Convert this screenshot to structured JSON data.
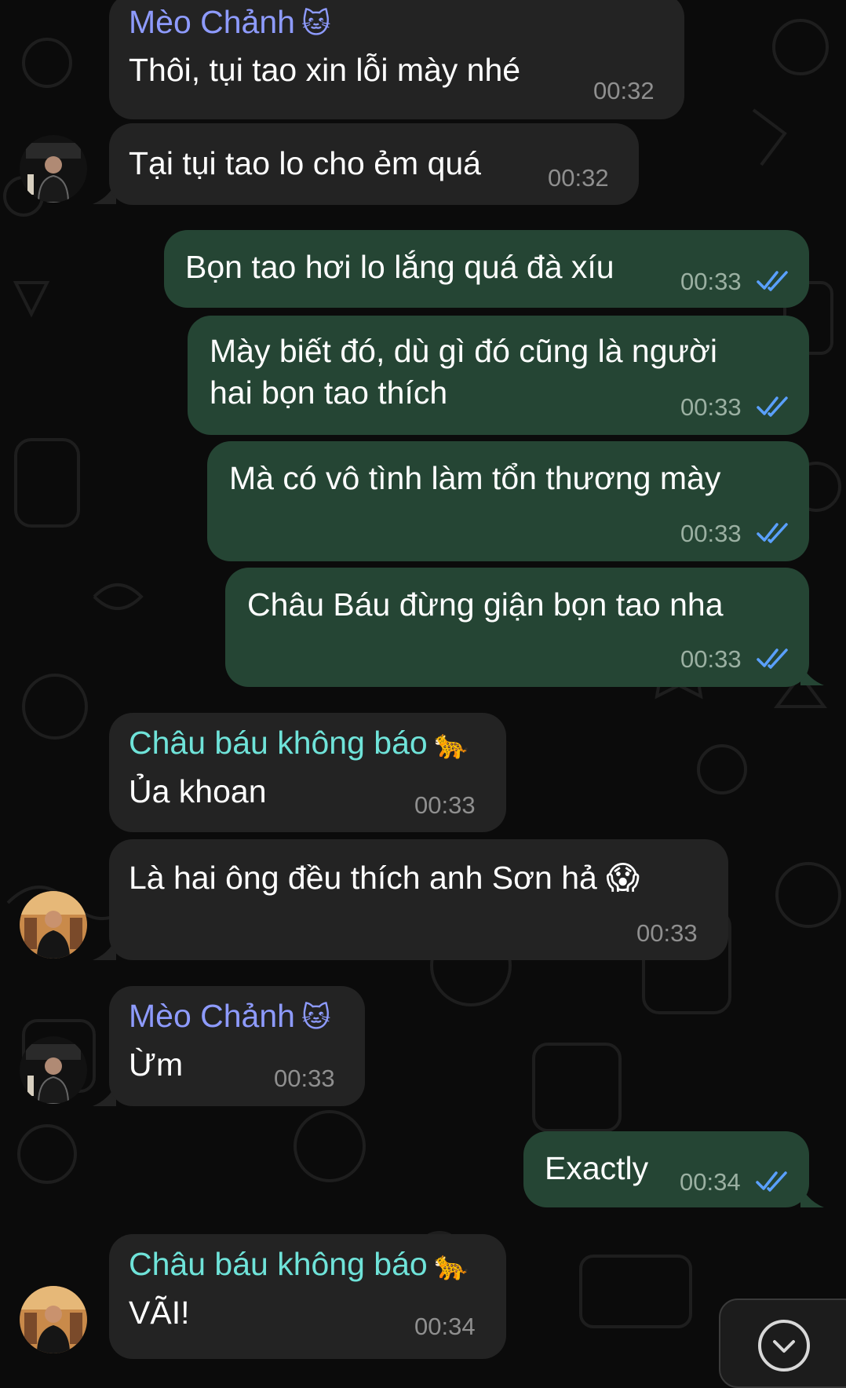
{
  "colors": {
    "background": "#0b0b0b",
    "incoming_bubble": "#232323",
    "outgoing_bubble": "#254534",
    "sender_meo": "#8e9bff",
    "sender_chau": "#6fe3d9",
    "read_ticks": "#5aa0ff"
  },
  "messages": [
    {
      "id": "m1",
      "dir": "in",
      "sender": "Mèo Chảnh",
      "sender_emoji": "🐱",
      "text": "Thôi, tụi tao xin lỗi mày nhé",
      "time": "00:32"
    },
    {
      "id": "m2",
      "dir": "in",
      "text": "Tại tụi tao lo cho ẻm quá",
      "time": "00:32",
      "avatar": "avatar-meo-chanh"
    },
    {
      "id": "m3",
      "dir": "out",
      "text": "Bọn tao hơi lo lắng quá đà xíu",
      "time": "00:33",
      "status": "read"
    },
    {
      "id": "m4",
      "dir": "out",
      "lines": [
        "Mày biết đó, dù gì đó cũng là người",
        "hai bọn tao thích"
      ],
      "time": "00:33",
      "status": "read"
    },
    {
      "id": "m5",
      "dir": "out",
      "text": "Mà có vô tình làm tổn thương mày",
      "time": "00:33",
      "status": "read"
    },
    {
      "id": "m6",
      "dir": "out",
      "text": "Châu Báu đừng giận bọn tao nha",
      "time": "00:33",
      "status": "read"
    },
    {
      "id": "m7",
      "dir": "in",
      "sender": "Châu báu không báo",
      "sender_emoji": "🐆",
      "text": "Ủa khoan",
      "time": "00:33"
    },
    {
      "id": "m8",
      "dir": "in",
      "text": "Là hai ông đều thích anh Sơn hả",
      "text_emoji": "😱",
      "time": "00:33",
      "avatar": "avatar-chau-bau"
    },
    {
      "id": "m9",
      "dir": "in",
      "sender": "Mèo Chảnh",
      "sender_emoji": "🐱",
      "text": "Ừm",
      "time": "00:33",
      "avatar": "avatar-meo-chanh"
    },
    {
      "id": "m10",
      "dir": "out",
      "text": "Exactly",
      "time": "00:34",
      "status": "read"
    },
    {
      "id": "m11",
      "dir": "in",
      "sender": "Châu báu không báo",
      "sender_emoji": "🐆",
      "text": "VÃI!",
      "time": "00:34",
      "avatar": "avatar-chau-bau"
    }
  ],
  "scroll_button_icon": "chevron-down-icon"
}
